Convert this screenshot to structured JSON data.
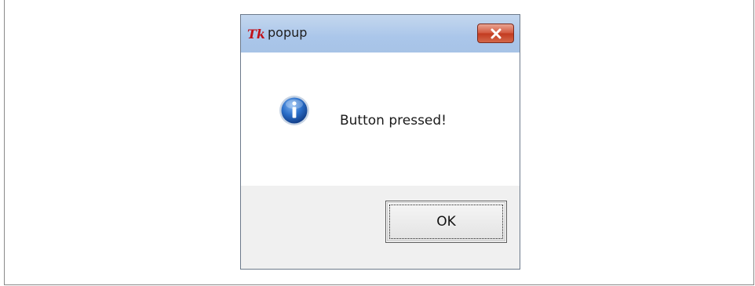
{
  "dialog": {
    "title": "popup",
    "message": "Button pressed!",
    "ok_label": "OK",
    "icons": {
      "app": "tk-feather-icon",
      "close": "close-icon",
      "info": "info-icon"
    }
  },
  "colors": {
    "titlebar": "#aac6ea",
    "close_button": "#c23a1f",
    "info_icon": "#1f5fb8"
  }
}
